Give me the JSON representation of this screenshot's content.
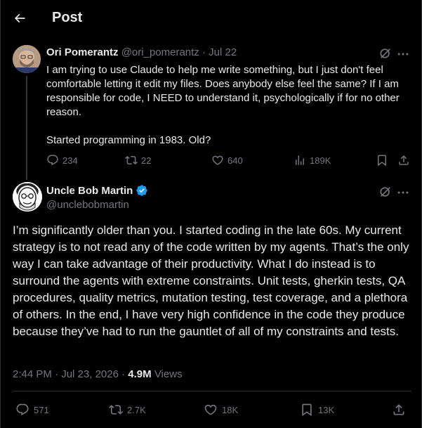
{
  "header": {
    "title": "Post",
    "back_icon": "arrow-left-icon"
  },
  "colors": {
    "background": "#000000",
    "text": "#e7e9ea",
    "muted": "#71767b",
    "verified": "#1d9bf0",
    "border": "#2f3336"
  },
  "parent_post": {
    "author_name": "Ori Pomerantz",
    "handle": "@ori_pomerantz",
    "separator": "·",
    "date": "Jul 22",
    "text_paragraphs": [
      "I am trying to use Claude to help me write something, but I just don't feel comfortable letting it edit my files. Does anybody else feel the same? If I am responsible for code, I NEED to understand it, psychologically if for no other reason.",
      "Started programming in 1983. Old?"
    ],
    "actions": {
      "replies": "234",
      "reposts": "22",
      "likes": "640",
      "views": "189K"
    }
  },
  "main_post": {
    "author_name": "Uncle Bob Martin",
    "verified": true,
    "handle": "@unclebobmartin",
    "text": "I’m significantly older than you. I started coding in the late 60s. My current strategy is to not read any of the code written by my agents. That’s the only way I can take advantage of their productivity. What I do instead is to surround the agents with extreme constraints. Unit tests, gherkin tests, QA procedures, quality metrics, mutation testing, test coverage, and a plethora of others. In the end, I have very high confidence in the code they produce because they’ve had to run the gauntlet of all of my constraints and tests.",
    "time": "2:44 PM",
    "separator": "·",
    "date": "Jul 23, 2026",
    "views_count": "4.9M",
    "views_label": "Views",
    "actions": {
      "replies": "571",
      "reposts": "2.7K",
      "likes": "18K",
      "bookmarks": "13K"
    }
  }
}
